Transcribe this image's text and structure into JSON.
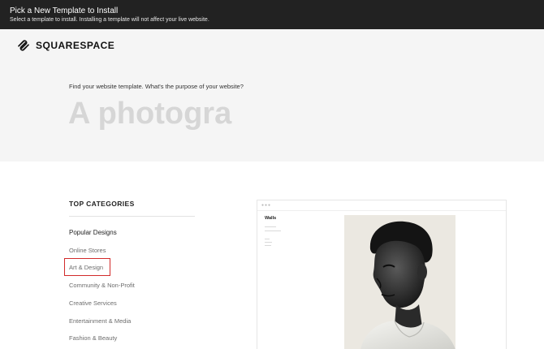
{
  "topbar": {
    "title": "Pick a New Template to Install",
    "subtitle": "Select a template to install. Installing a template will not affect your live website."
  },
  "hero": {
    "logo_text": "SQUARESPACE",
    "prompt": "Find your website template. What's the purpose of your website?",
    "search_value": "A photogra"
  },
  "categories": {
    "title": "TOP CATEGORIES",
    "items": [
      {
        "label": "Popular Designs"
      },
      {
        "label": "Online Stores"
      },
      {
        "label": "Art & Design"
      },
      {
        "label": "Community & Non-Profit"
      },
      {
        "label": "Creative Services"
      },
      {
        "label": "Entertainment & Media"
      },
      {
        "label": "Fashion & Beauty"
      }
    ]
  },
  "preview": {
    "site_title": "Walls"
  }
}
